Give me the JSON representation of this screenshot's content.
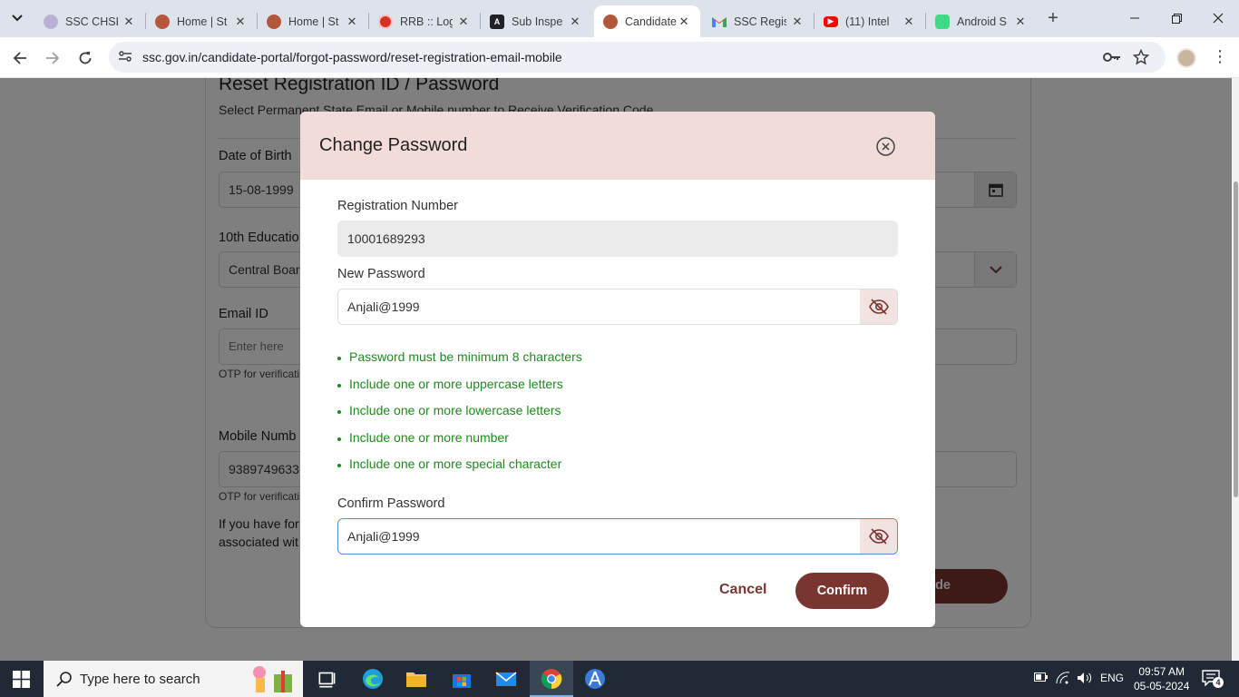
{
  "browser": {
    "tabs": [
      {
        "title": "SSC CHSL",
        "icon": "ssc-logo-icon"
      },
      {
        "title": "Home | St",
        "icon": "emblem-icon"
      },
      {
        "title": "Home | St",
        "icon": "emblem-icon"
      },
      {
        "title": "RRB :: Log",
        "icon": "rrb-logo-icon"
      },
      {
        "title": "Sub Inspe",
        "icon": "angular-logo-icon"
      },
      {
        "title": "Candidate",
        "icon": "emblem-icon",
        "active": true
      },
      {
        "title": "SSC Regis",
        "icon": "gmail-icon"
      },
      {
        "title": "(11) Intel",
        "icon": "youtube-icon"
      },
      {
        "title": "Android S",
        "icon": "android-icon"
      }
    ],
    "url": "ssc.gov.in/candidate-portal/forgot-password/reset-registration-email-mobile"
  },
  "page": {
    "heading": "Reset Registration ID / Password",
    "subheading": "Select Permanent State Email or Mobile number to Receive Verification Code",
    "dob_label": "Date of Birth",
    "dob_value": "15-08-1999",
    "edu_label": "10th Educatio",
    "edu_value": "Central Boar",
    "email_label": "Email ID",
    "email_placeholder": "Enter here",
    "email_note": "OTP for verificati",
    "mobile_label": "Mobile Numb",
    "mobile_value": "9389749633",
    "mobile_note": "OTP for verificati",
    "info_line1": "If you have for",
    "info_line2": "associated wit",
    "send_button": "on Code"
  },
  "modal": {
    "title": "Change Password",
    "reg_label": "Registration Number",
    "reg_value": "10001689293",
    "new_pw_label": "New Password",
    "new_pw_value": "Anjali@1999",
    "rules": [
      "Password must be minimum 8 characters",
      "Include one or more uppercase letters",
      "Include one or more lowercase letters",
      "Include one or more number",
      "Include one or more special character"
    ],
    "confirm_pw_label": "Confirm Password",
    "confirm_pw_value": "Anjali@1999",
    "cancel": "Cancel",
    "confirm": "Confirm"
  },
  "taskbar": {
    "search_placeholder": "Type here to search",
    "lang": "ENG",
    "time": "09:57 AM",
    "date": "05-05-2024",
    "notifications": "4"
  },
  "colors": {
    "accent": "#7a3530",
    "modal_header": "#f1dcd9",
    "rule_text": "#1e8a1e"
  }
}
